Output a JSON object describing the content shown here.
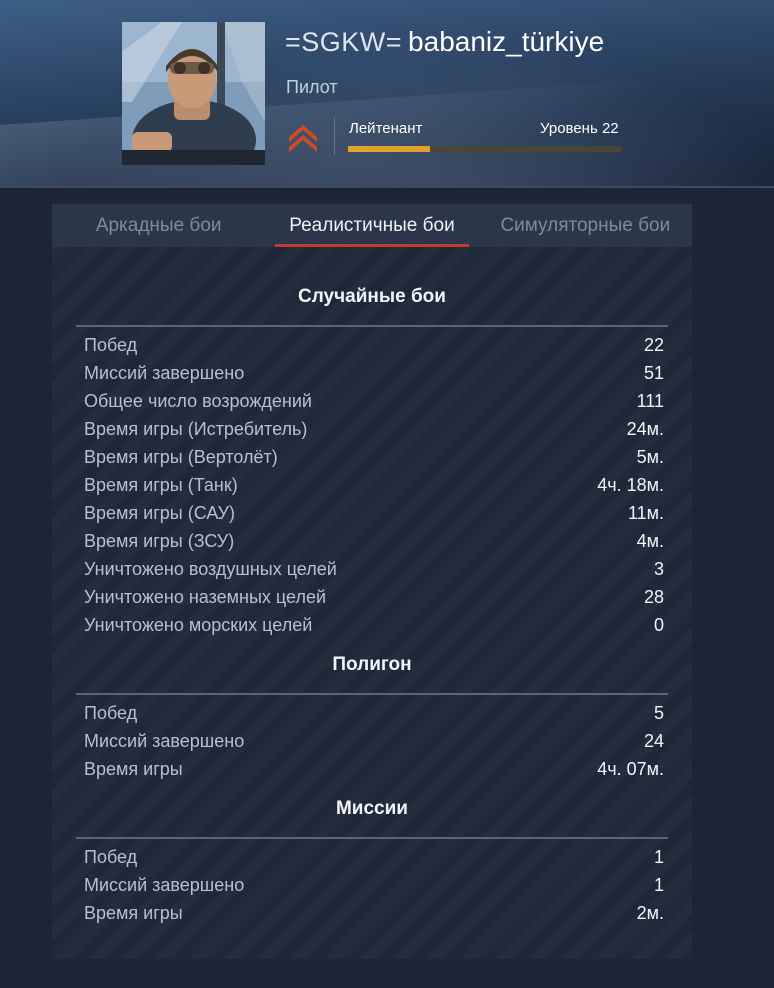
{
  "profile": {
    "clan_tag": "=SGKW=",
    "nickname": "babaniz_türkiye",
    "title": "Пилот",
    "rank_name": "Лейтенант",
    "level_label": "Уровень 22",
    "level_progress": 0.3,
    "colors": {
      "progress": "#e0a228",
      "rank_chevron": "#d24a2a"
    }
  },
  "tabs": [
    {
      "label": "Аркадные бои",
      "active": false
    },
    {
      "label": "Реалистичные бои",
      "active": true
    },
    {
      "label": "Симуляторные бои",
      "active": false
    }
  ],
  "sections": [
    {
      "title": "Случайные бои",
      "rows": [
        {
          "label": "Побед",
          "value": "22"
        },
        {
          "label": "Миссий завершено",
          "value": "51"
        },
        {
          "label": "Общее число возрождений",
          "value": "111"
        },
        {
          "label": "Время игры (Истребитель)",
          "value": "24м."
        },
        {
          "label": "Время игры (Вертолёт)",
          "value": "5м."
        },
        {
          "label": "Время игры (Танк)",
          "value": "4ч. 18м."
        },
        {
          "label": "Время игры (САУ)",
          "value": "11м."
        },
        {
          "label": "Время игры (ЗСУ)",
          "value": "4м."
        },
        {
          "label": "Уничтожено воздушных целей",
          "value": "3"
        },
        {
          "label": "Уничтожено наземных целей",
          "value": "28"
        },
        {
          "label": "Уничтожено морских целей",
          "value": "0"
        }
      ]
    },
    {
      "title": "Полигон",
      "rows": [
        {
          "label": "Побед",
          "value": "5"
        },
        {
          "label": "Миссий завершено",
          "value": "24"
        },
        {
          "label": "Время игры",
          "value": "4ч. 07м."
        }
      ]
    },
    {
      "title": "Миссии",
      "rows": [
        {
          "label": "Побед",
          "value": "1"
        },
        {
          "label": "Миссий завершено",
          "value": "1"
        },
        {
          "label": "Время игры",
          "value": "2м."
        }
      ]
    }
  ]
}
